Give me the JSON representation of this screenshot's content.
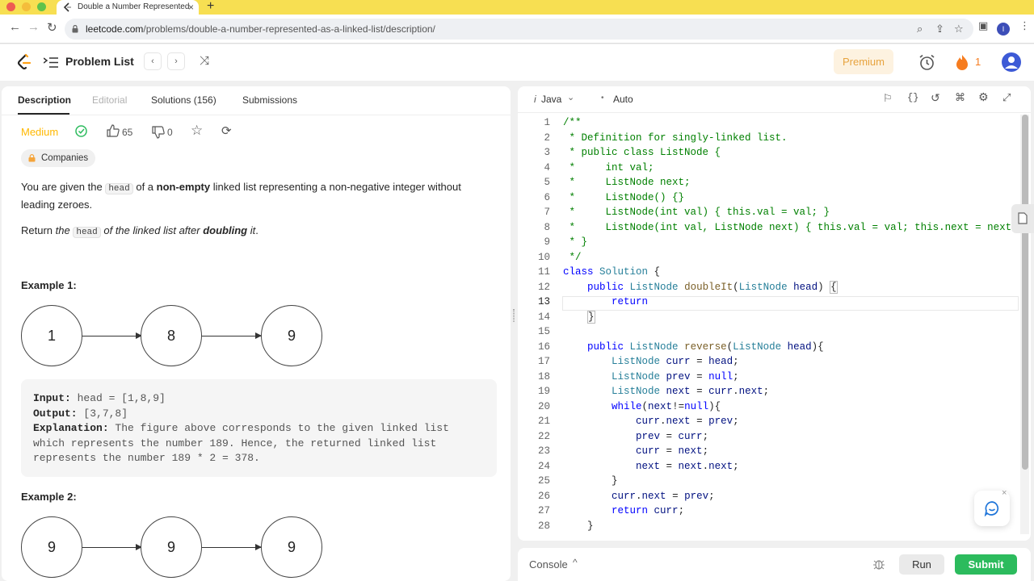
{
  "browser": {
    "tab_title": "Double a Number Represented",
    "url_host": "leetcode.com",
    "url_path": "/problems/double-a-number-represented-as-a-linked-list/description/",
    "profile_initial": "I"
  },
  "header": {
    "problem_list": "Problem List",
    "premium": "Premium",
    "streak": "1"
  },
  "left_tabs": {
    "description": "Description",
    "editorial": "Editorial",
    "solutions": "Solutions (156)",
    "submissions": "Submissions"
  },
  "meta": {
    "difficulty": "Medium",
    "likes": "65",
    "dislikes": "0",
    "companies": "Companies"
  },
  "desc": {
    "p1_a": "You are given the ",
    "p1_code": "head",
    "p1_b": " of a ",
    "p1_bold": "non-empty",
    "p1_c": " linked list representing a non-negative integer without leading zeroes.",
    "p2_a": "Return ",
    "p2_b": "the",
    "p2_code": "head",
    "p2_c": " of the linked list after ",
    "p2_bold": "doubling",
    "p2_d": " it",
    "p2_e": "."
  },
  "example1": {
    "heading": "Example 1:",
    "nodes": [
      "1",
      "8",
      "9"
    ],
    "input_label": "Input:",
    "input": " head = [1,8,9]",
    "output_label": "Output:",
    "output": " [3,7,8]",
    "expl_label": "Explanation:",
    "expl_1": " The figure above corresponds to the given linked list",
    "expl_2": "which represents the number 189. Hence, the returned linked list",
    "expl_3": "represents the number 189 * 2 = 378."
  },
  "example2": {
    "heading": "Example 2:",
    "nodes": [
      "9",
      "9",
      "9"
    ]
  },
  "editor": {
    "language": "Java",
    "mode": "Auto",
    "line_numbers": [
      "1",
      "2",
      "3",
      "4",
      "5",
      "6",
      "7",
      "8",
      "9",
      "10",
      "11",
      "12",
      "13",
      "14",
      "15",
      "16",
      "17",
      "18",
      "19",
      "20",
      "21",
      "22",
      "23",
      "24",
      "25",
      "26",
      "27",
      "28"
    ]
  },
  "console": {
    "label": "Console",
    "run": "Run",
    "submit": "Submit"
  },
  "colors": {
    "accent_green": "#2cbb5d",
    "medium": "#ffb800",
    "premium": "#e7a33e",
    "tab_bar": "#f7df52"
  }
}
